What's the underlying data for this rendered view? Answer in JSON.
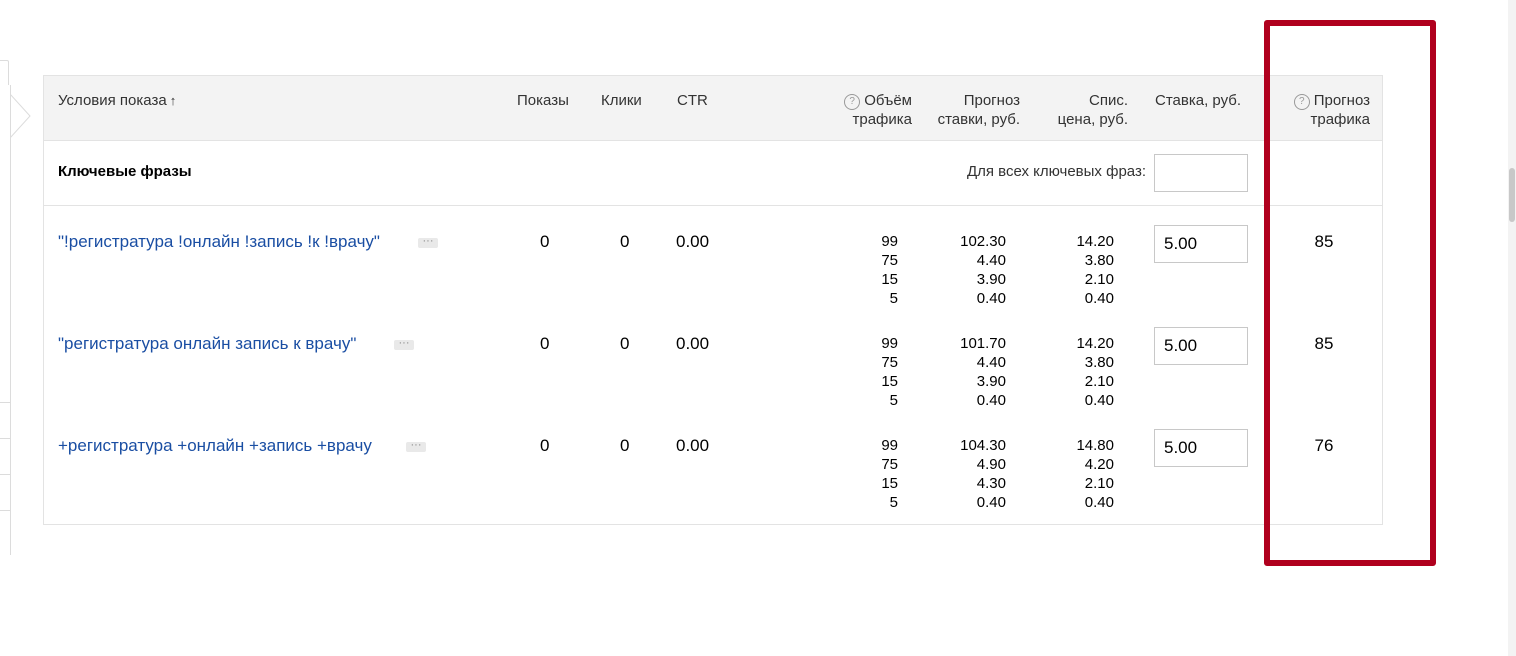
{
  "header": {
    "conditions": "Условия показа",
    "sort_arrow": "↑",
    "impressions": "Показы",
    "clicks": "Клики",
    "ctr": "CTR",
    "traffic_volume_1": "Объём",
    "traffic_volume_2": "трафика",
    "bid_forecast_1": "Прогноз",
    "bid_forecast_2": "ставки, руб.",
    "writeoff_1": "Спис.",
    "writeoff_2": "цена, руб.",
    "bid": "Ставка, руб.",
    "traffic_forecast_1": "Прогноз",
    "traffic_forecast_2": "трафика",
    "help_glyph": "?"
  },
  "section": {
    "title": "Ключевые фразы",
    "all_phrases_label": "Для всех ключевых фраз:",
    "all_phrases_value": ""
  },
  "rows": [
    {
      "phrase": "\"!регистратура !онлайн !запись !к !врачу\"",
      "impressions": "0",
      "clicks": "0",
      "ctr": "0.00",
      "volumes": [
        "99",
        "75",
        "15",
        "5"
      ],
      "bid_forecasts": [
        "102.30",
        "4.40",
        "3.90",
        "0.40"
      ],
      "writeoff": [
        "14.20",
        "3.80",
        "2.10",
        "0.40"
      ],
      "bid": "5.00",
      "traffic_forecast": "85",
      "more": "···"
    },
    {
      "phrase": "\"регистратура онлайн запись к врачу\"",
      "impressions": "0",
      "clicks": "0",
      "ctr": "0.00",
      "volumes": [
        "99",
        "75",
        "15",
        "5"
      ],
      "bid_forecasts": [
        "101.70",
        "4.40",
        "3.90",
        "0.40"
      ],
      "writeoff": [
        "14.20",
        "3.80",
        "2.10",
        "0.40"
      ],
      "bid": "5.00",
      "traffic_forecast": "85",
      "more": "···"
    },
    {
      "phrase": "+регистратура +онлайн +запись +врачу",
      "impressions": "0",
      "clicks": "0",
      "ctr": "0.00",
      "volumes": [
        "99",
        "75",
        "15",
        "5"
      ],
      "bid_forecasts": [
        "104.30",
        "4.90",
        "4.30",
        "0.40"
      ],
      "writeoff": [
        "14.80",
        "4.20",
        "2.10",
        "0.40"
      ],
      "bid": "5.00",
      "traffic_forecast": "76",
      "more": "···"
    }
  ],
  "colors": {
    "link": "#1a4ea3",
    "header_bg": "#f3f3f3",
    "highlight": "#b0001e"
  }
}
